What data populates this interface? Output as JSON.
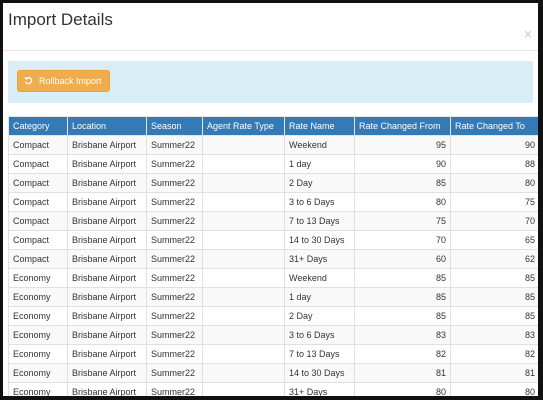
{
  "modal": {
    "title": "Import Details",
    "close_label": "×"
  },
  "toolbar": {
    "rollback_label": "Rollback Import",
    "icon": "undo-icon"
  },
  "colors": {
    "header_bg": "#337ab7",
    "toolbar_bg": "#d9edf7",
    "button_bg": "#f0ad4e"
  },
  "table": {
    "columns": [
      "Category",
      "Location",
      "Season",
      "Agent Rate Type",
      "Rate Name",
      "Rate Changed From",
      "Rate Changed To"
    ],
    "rows": [
      [
        "Compact",
        "Brisbane Airport",
        "Summer22",
        "",
        "Weekend",
        "95",
        "90"
      ],
      [
        "Compact",
        "Brisbane Airport",
        "Summer22",
        "",
        "1 day",
        "90",
        "88"
      ],
      [
        "Compact",
        "Brisbane Airport",
        "Summer22",
        "",
        "2 Day",
        "85",
        "80"
      ],
      [
        "Compact",
        "Brisbane Airport",
        "Summer22",
        "",
        "3 to 6 Days",
        "80",
        "75"
      ],
      [
        "Compact",
        "Brisbane Airport",
        "Summer22",
        "",
        "7 to 13 Days",
        "75",
        "70"
      ],
      [
        "Compact",
        "Brisbane Airport",
        "Summer22",
        "",
        "14 to 30 Days",
        "70",
        "65"
      ],
      [
        "Compact",
        "Brisbane Airport",
        "Summer22",
        "",
        "31+ Days",
        "60",
        "62"
      ],
      [
        "Economy",
        "Brisbane Airport",
        "Summer22",
        "",
        "Weekend",
        "85",
        "85"
      ],
      [
        "Economy",
        "Brisbane Airport",
        "Summer22",
        "",
        "1 day",
        "85",
        "85"
      ],
      [
        "Economy",
        "Brisbane Airport",
        "Summer22",
        "",
        "2 Day",
        "85",
        "85"
      ],
      [
        "Economy",
        "Brisbane Airport",
        "Summer22",
        "",
        "3 to 6 Days",
        "83",
        "83"
      ],
      [
        "Economy",
        "Brisbane Airport",
        "Summer22",
        "",
        "7 to 13 Days",
        "82",
        "82"
      ],
      [
        "Economy",
        "Brisbane Airport",
        "Summer22",
        "",
        "14 to 30 Days",
        "81",
        "81"
      ],
      [
        "Economy",
        "Brisbane Airport",
        "Summer22",
        "",
        "31+ Days",
        "80",
        "80"
      ]
    ]
  }
}
